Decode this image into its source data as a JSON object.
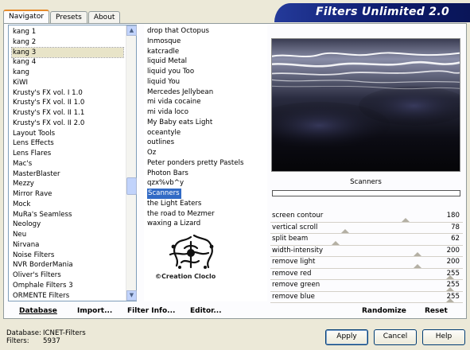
{
  "tabs": [
    "Navigator",
    "Presets",
    "About"
  ],
  "title": "Filters Unlimited 2.0",
  "categories": [
    "kang 1",
    "kang 2",
    "kang 3",
    "kang 4",
    "kang",
    "KiWI",
    "Krusty's FX vol. I 1.0",
    "Krusty's FX vol. II 1.0",
    "Krusty's FX vol. II 1.1",
    "Krusty's FX vol. II 2.0",
    "Layout Tools",
    "Lens Effects",
    "Lens Flares",
    "Mac's",
    "MasterBlaster",
    "Mezzy",
    "Mirror Rave",
    "Mock",
    "MuRa's Seamless",
    "Neology",
    "Neu",
    "Nirvana",
    "Noise Filters",
    "NVR BorderMania",
    "Oliver's Filters",
    "Omphale Filters 3",
    "ORMENTE Filters"
  ],
  "selected_category_index": 2,
  "filters": [
    "drop that Octopus",
    "Inmosque",
    "katcradle",
    "liquid Metal",
    "liquid you Too",
    "liquid You",
    "Mercedes Jellybean",
    "mi vida cocaine",
    "mi vida loco",
    "My Baby eats Light",
    "oceantyle",
    "outlines",
    "Oz",
    "Peter ponders pretty Pastels",
    "Photon Bars",
    "qzx%vb^y",
    "Scanners",
    "the Light Eaters",
    "the road to Mezmer",
    "waxing a Lizard"
  ],
  "selected_filter_index": 16,
  "logo_text": "©Creation Cloclo",
  "preview": {
    "filter_name": "Scanners"
  },
  "sliders": [
    {
      "label": "screen contour",
      "value": "180",
      "level": 0.706
    },
    {
      "label": "vertical scroll",
      "value": "78",
      "level": 0.306
    },
    {
      "label": "split beam",
      "value": "62",
      "level": 0.243
    },
    {
      "label": "width-intensity",
      "value": "200",
      "level": 0.784
    },
    {
      "label": "remove light",
      "value": "200",
      "level": 0.784
    },
    {
      "label": "remove red",
      "value": "255",
      "level": 1.0
    },
    {
      "label": "remove green",
      "value": "255",
      "level": 1.0
    },
    {
      "label": "remove blue",
      "value": "255",
      "level": 1.0
    }
  ],
  "links": {
    "database": "Database",
    "import": "Import...",
    "filter_info": "Filter Info...",
    "editor": "Editor...",
    "randomize": "Randomize",
    "reset": "Reset"
  },
  "status": {
    "database_label": "Database:",
    "database_value": "ICNET-Filters",
    "filters_label": "Filters:",
    "filters_value": "5937"
  },
  "buttons": {
    "apply": "Apply",
    "cancel": "Cancel",
    "help": "Help"
  },
  "colors": {
    "selection": "#316ac5",
    "banner": "#0c1a6b"
  }
}
